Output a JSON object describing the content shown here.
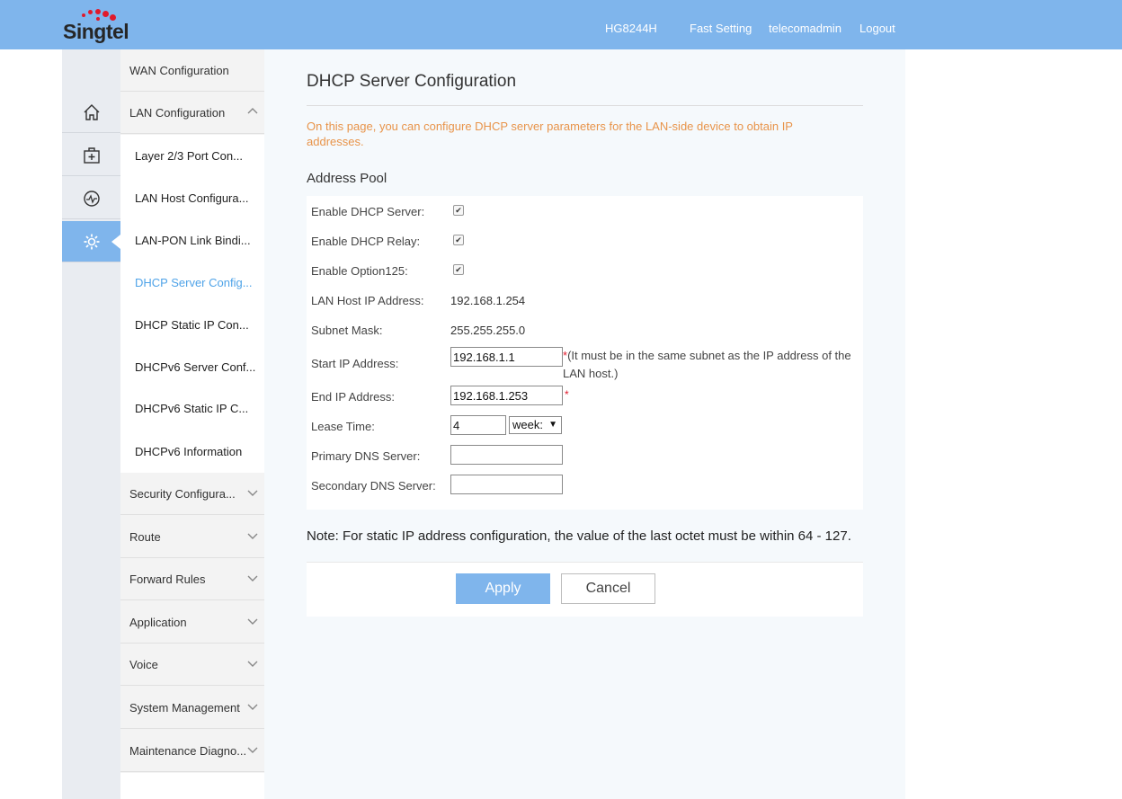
{
  "header": {
    "brand": "Singtel",
    "model": "HG8244H",
    "fast_setting": "Fast Setting",
    "user": "telecomadmin",
    "logout": "Logout"
  },
  "sidebar_icons": [
    "home-icon",
    "toolbox-icon",
    "status-icon",
    "settings-icon"
  ],
  "menu": {
    "wan": "WAN Configuration",
    "lan": "LAN Configuration",
    "sub": [
      "Layer 2/3 Port Con...",
      "LAN Host Configura...",
      "LAN-PON Link Bindi...",
      "DHCP Server Config...",
      "DHCP Static IP Con...",
      "DHCPv6 Server Conf...",
      "DHCPv6 Static IP C...",
      "DHCPv6 Information"
    ],
    "groups": [
      "Security Configura...",
      "Route",
      "Forward Rules",
      "Application",
      "Voice",
      "System Management",
      "Maintenance Diagno..."
    ]
  },
  "page": {
    "title": "DHCP Server Configuration",
    "intro": "On this page, you can configure DHCP server parameters for the LAN-side device to obtain IP addresses.",
    "section": "Address Pool"
  },
  "form": {
    "enable_dhcp_label": "Enable DHCP Server:",
    "enable_relay_label": "Enable DHCP Relay:",
    "enable_opt125_label": "Enable Option125:",
    "lan_ip_label": "LAN Host IP Address:",
    "lan_ip_value": "192.168.1.254",
    "subnet_label": "Subnet Mask:",
    "subnet_value": "255.255.255.0",
    "start_ip_label": "Start IP Address:",
    "start_ip_value": "192.168.1.1",
    "start_hint": "*(It must be in the same subnet as the IP address of the LAN host.)",
    "end_ip_label": "End IP Address:",
    "end_ip_value": "192.168.1.253",
    "required_mark": "*",
    "lease_label": "Lease Time:",
    "lease_value": "4",
    "lease_unit": "week:",
    "dns1_label": "Primary DNS Server:",
    "dns1_value": "",
    "dns2_label": "Secondary DNS Server:",
    "dns2_value": "",
    "check_mark": "✔"
  },
  "note": "Note: For static IP address configuration, the value of the last octet must be within 64 - 127.",
  "buttons": {
    "apply": "Apply",
    "cancel": "Cancel"
  },
  "colors": {
    "header": "#7fb5ec",
    "active_menu": "#4fa3e8",
    "intro_text": "#e8944a",
    "brand_red": "#e0192b"
  }
}
